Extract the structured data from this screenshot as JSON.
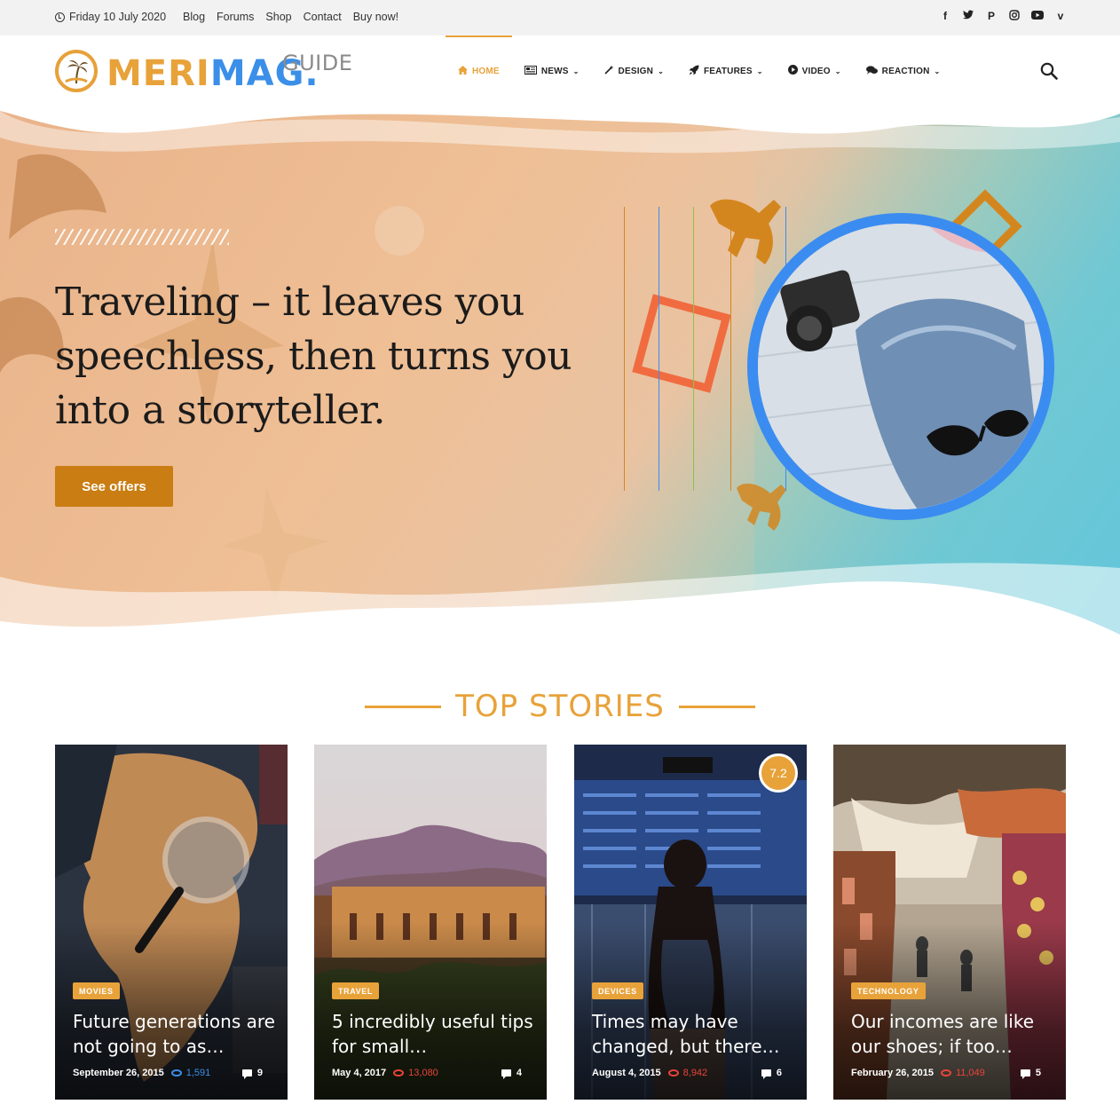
{
  "topbar": {
    "date": "Friday 10 July 2020",
    "links": [
      "Blog",
      "Forums",
      "Shop",
      "Contact",
      "Buy now!"
    ],
    "social_icons": [
      "facebook-icon",
      "twitter-icon",
      "pinterest-icon",
      "instagram-icon",
      "youtube-icon",
      "vimeo-icon"
    ]
  },
  "logo": {
    "part1": "MERI",
    "part2": "MAG",
    "dot": ".",
    "part3": "GUIDE"
  },
  "nav": {
    "items": [
      {
        "label": "Home",
        "icon": "home-icon",
        "active": true
      },
      {
        "label": "News",
        "icon": "newspaper-icon",
        "dropdown": true
      },
      {
        "label": "Design",
        "icon": "magic-wand-icon",
        "dropdown": true
      },
      {
        "label": "Features",
        "icon": "rocket-icon",
        "dropdown": true
      },
      {
        "label": "Video",
        "icon": "play-icon",
        "dropdown": true
      },
      {
        "label": "Reaction",
        "icon": "comments-icon",
        "dropdown": true
      }
    ]
  },
  "hero": {
    "title": "Traveling – it leaves you speechless, then turns you into a storyteller.",
    "button": "See offers"
  },
  "section": {
    "title": "TOP STORIES"
  },
  "cards": [
    {
      "category": "MOVIES",
      "title": "Future generations are not going to as…",
      "date": "September 26, 2015",
      "views": "1,591",
      "views_color": "#3b8fe8",
      "comments": "9"
    },
    {
      "category": "TRAVEL",
      "title": "5 incredibly useful tips for small…",
      "date": "May 4, 2017",
      "views": "13,080",
      "views_color": "#e8443a",
      "comments": "4"
    },
    {
      "category": "DEVICES",
      "title": "Times may have changed, but there…",
      "date": "August 4, 2015",
      "views": "8,942",
      "views_color": "#e8443a",
      "comments": "6",
      "score": "7.2"
    },
    {
      "category": "TECHNOLOGY",
      "title": "Our incomes are like our shoes; if too…",
      "date": "February 26, 2015",
      "views": "11,049",
      "views_color": "#e8443a",
      "comments": "5"
    }
  ],
  "colors": {
    "accent": "#e8a23a",
    "blue": "#3b8fe8",
    "button": "#c97d12"
  }
}
